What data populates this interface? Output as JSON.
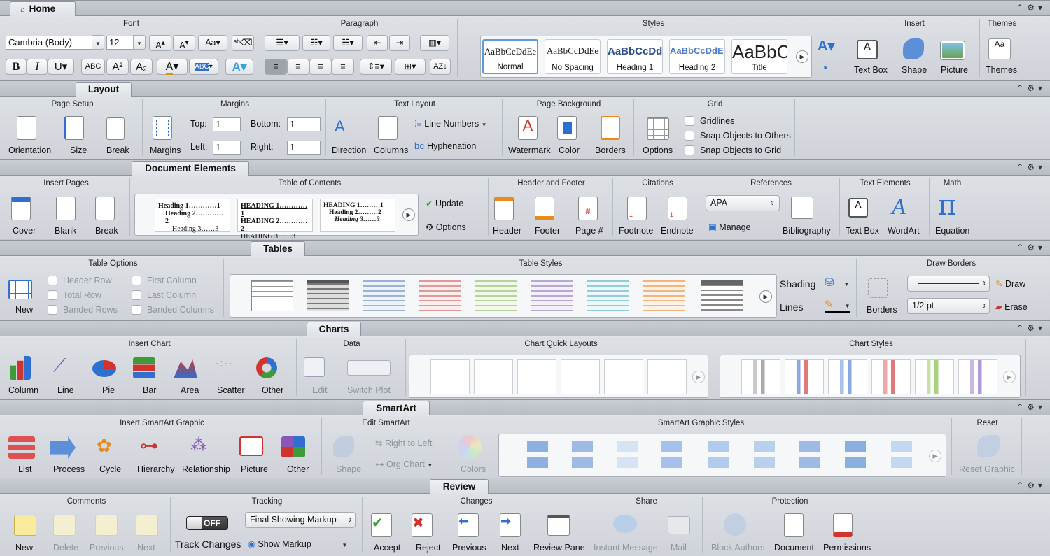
{
  "home": {
    "tab": "Home",
    "font": {
      "title": "Font",
      "name": "Cambria (Body)",
      "size": "12"
    },
    "paragraph": {
      "title": "Paragraph"
    },
    "styles": {
      "title": "Styles",
      "items": [
        {
          "preview": "AaBbCcDdEe",
          "name": "Normal"
        },
        {
          "preview": "AaBbCcDdEe",
          "name": "No Spacing"
        },
        {
          "preview": "AaBbCcDd",
          "name": "Heading 1"
        },
        {
          "preview": "AaBbCcDdEe",
          "name": "Heading 2"
        },
        {
          "preview": "AaBbC",
          "name": "Title"
        }
      ]
    },
    "insert": {
      "title": "Insert",
      "items": [
        "Text Box",
        "Shape",
        "Picture"
      ]
    },
    "themes": {
      "title": "Themes",
      "label": "Themes"
    }
  },
  "layout": {
    "tab": "Layout",
    "page_setup": {
      "title": "Page Setup",
      "items": [
        "Orientation",
        "Size",
        "Break"
      ]
    },
    "margins": {
      "title": "Margins",
      "label": "Margins",
      "top_label": "Top:",
      "top": "1",
      "bottom_label": "Bottom:",
      "bottom": "1",
      "left_label": "Left:",
      "left": "1",
      "right_label": "Right:",
      "right": "1"
    },
    "text_layout": {
      "title": "Text Layout",
      "direction": "Direction",
      "columns": "Columns",
      "line_numbers": "Line Numbers",
      "hyphenation": "Hyphenation"
    },
    "page_background": {
      "title": "Page Background",
      "items": [
        "Watermark",
        "Color",
        "Borders"
      ]
    },
    "grid": {
      "title": "Grid",
      "options": "Options",
      "gridlines": "Gridlines",
      "snap_others": "Snap Objects to Others",
      "snap_grid": "Snap Objects to Grid"
    }
  },
  "doc": {
    "tab": "Document Elements",
    "insert_pages": {
      "title": "Insert Pages",
      "items": [
        "Cover",
        "Blank",
        "Break"
      ]
    },
    "toc": {
      "title": "Table of Contents",
      "update": "Update",
      "options": "Options",
      "h1": "Heading 1",
      "h2": "Heading 2",
      "h3": "Heading 3",
      "cap1": "HEADING 1",
      "cap2": "HEADING 2",
      "cap3": "HEADING 3"
    },
    "header_footer": {
      "title": "Header and Footer",
      "items": [
        "Header",
        "Footer",
        "Page #"
      ]
    },
    "citations": {
      "title": "Citations",
      "items": [
        "Footnote",
        "Endnote"
      ]
    },
    "references": {
      "title": "References",
      "style": "APA",
      "manage": "Manage",
      "bibliography": "Bibliography"
    },
    "text_elements": {
      "title": "Text Elements",
      "items": [
        "Text Box",
        "WordArt"
      ]
    },
    "math": {
      "title": "Math",
      "label": "Equation"
    }
  },
  "tables": {
    "tab": "Tables",
    "new": "New",
    "options": {
      "title": "Table Options",
      "header_row": "Header Row",
      "total_row": "Total Row",
      "banded_rows": "Banded Rows",
      "first_column": "First Column",
      "last_column": "Last Column",
      "banded_columns": "Banded Columns"
    },
    "styles": {
      "title": "Table Styles",
      "shading": "Shading",
      "lines": "Lines"
    },
    "draw": {
      "title": "Draw Borders",
      "borders": "Borders",
      "weight": "1/2 pt",
      "draw": "Draw",
      "erase": "Erase"
    }
  },
  "charts": {
    "tab": "Charts",
    "insert": {
      "title": "Insert Chart",
      "items": [
        "Column",
        "Line",
        "Pie",
        "Bar",
        "Area",
        "Scatter",
        "Other"
      ]
    },
    "data": {
      "title": "Data",
      "edit": "Edit",
      "switch": "Switch Plot"
    },
    "layouts": {
      "title": "Chart Quick Layouts"
    },
    "styles": {
      "title": "Chart Styles"
    }
  },
  "smartart": {
    "tab": "SmartArt",
    "insert": {
      "title": "Insert SmartArt Graphic",
      "items": [
        "List",
        "Process",
        "Cycle",
        "Hierarchy",
        "Relationship",
        "Picture",
        "Other"
      ]
    },
    "edit": {
      "title": "Edit SmartArt",
      "shape": "Shape",
      "rtl": "Right to Left",
      "org": "Org Chart"
    },
    "styles": {
      "title": "SmartArt Graphic Styles",
      "colors": "Colors"
    },
    "reset": {
      "title": "Reset",
      "label": "Reset Graphic"
    }
  },
  "review": {
    "tab": "Review",
    "comments": {
      "title": "Comments",
      "items": [
        "New",
        "Delete",
        "Previous",
        "Next"
      ]
    },
    "tracking": {
      "title": "Tracking",
      "toggle": "OFF",
      "track": "Track Changes",
      "mode": "Final Showing Markup",
      "show": "Show Markup"
    },
    "changes": {
      "title": "Changes",
      "items": [
        "Accept",
        "Reject",
        "Previous",
        "Next",
        "Review Pane"
      ]
    },
    "share": {
      "title": "Share",
      "items": [
        "Instant Message",
        "Mail"
      ]
    },
    "protection": {
      "title": "Protection",
      "items": [
        "Block Authors",
        "Document",
        "Permissions"
      ]
    }
  },
  "colors": {
    "blue": "#2f6fd0",
    "red": "#d0342c",
    "green": "#3f9b3a",
    "orange": "#e98a1c",
    "purple": "#8a56b8"
  }
}
